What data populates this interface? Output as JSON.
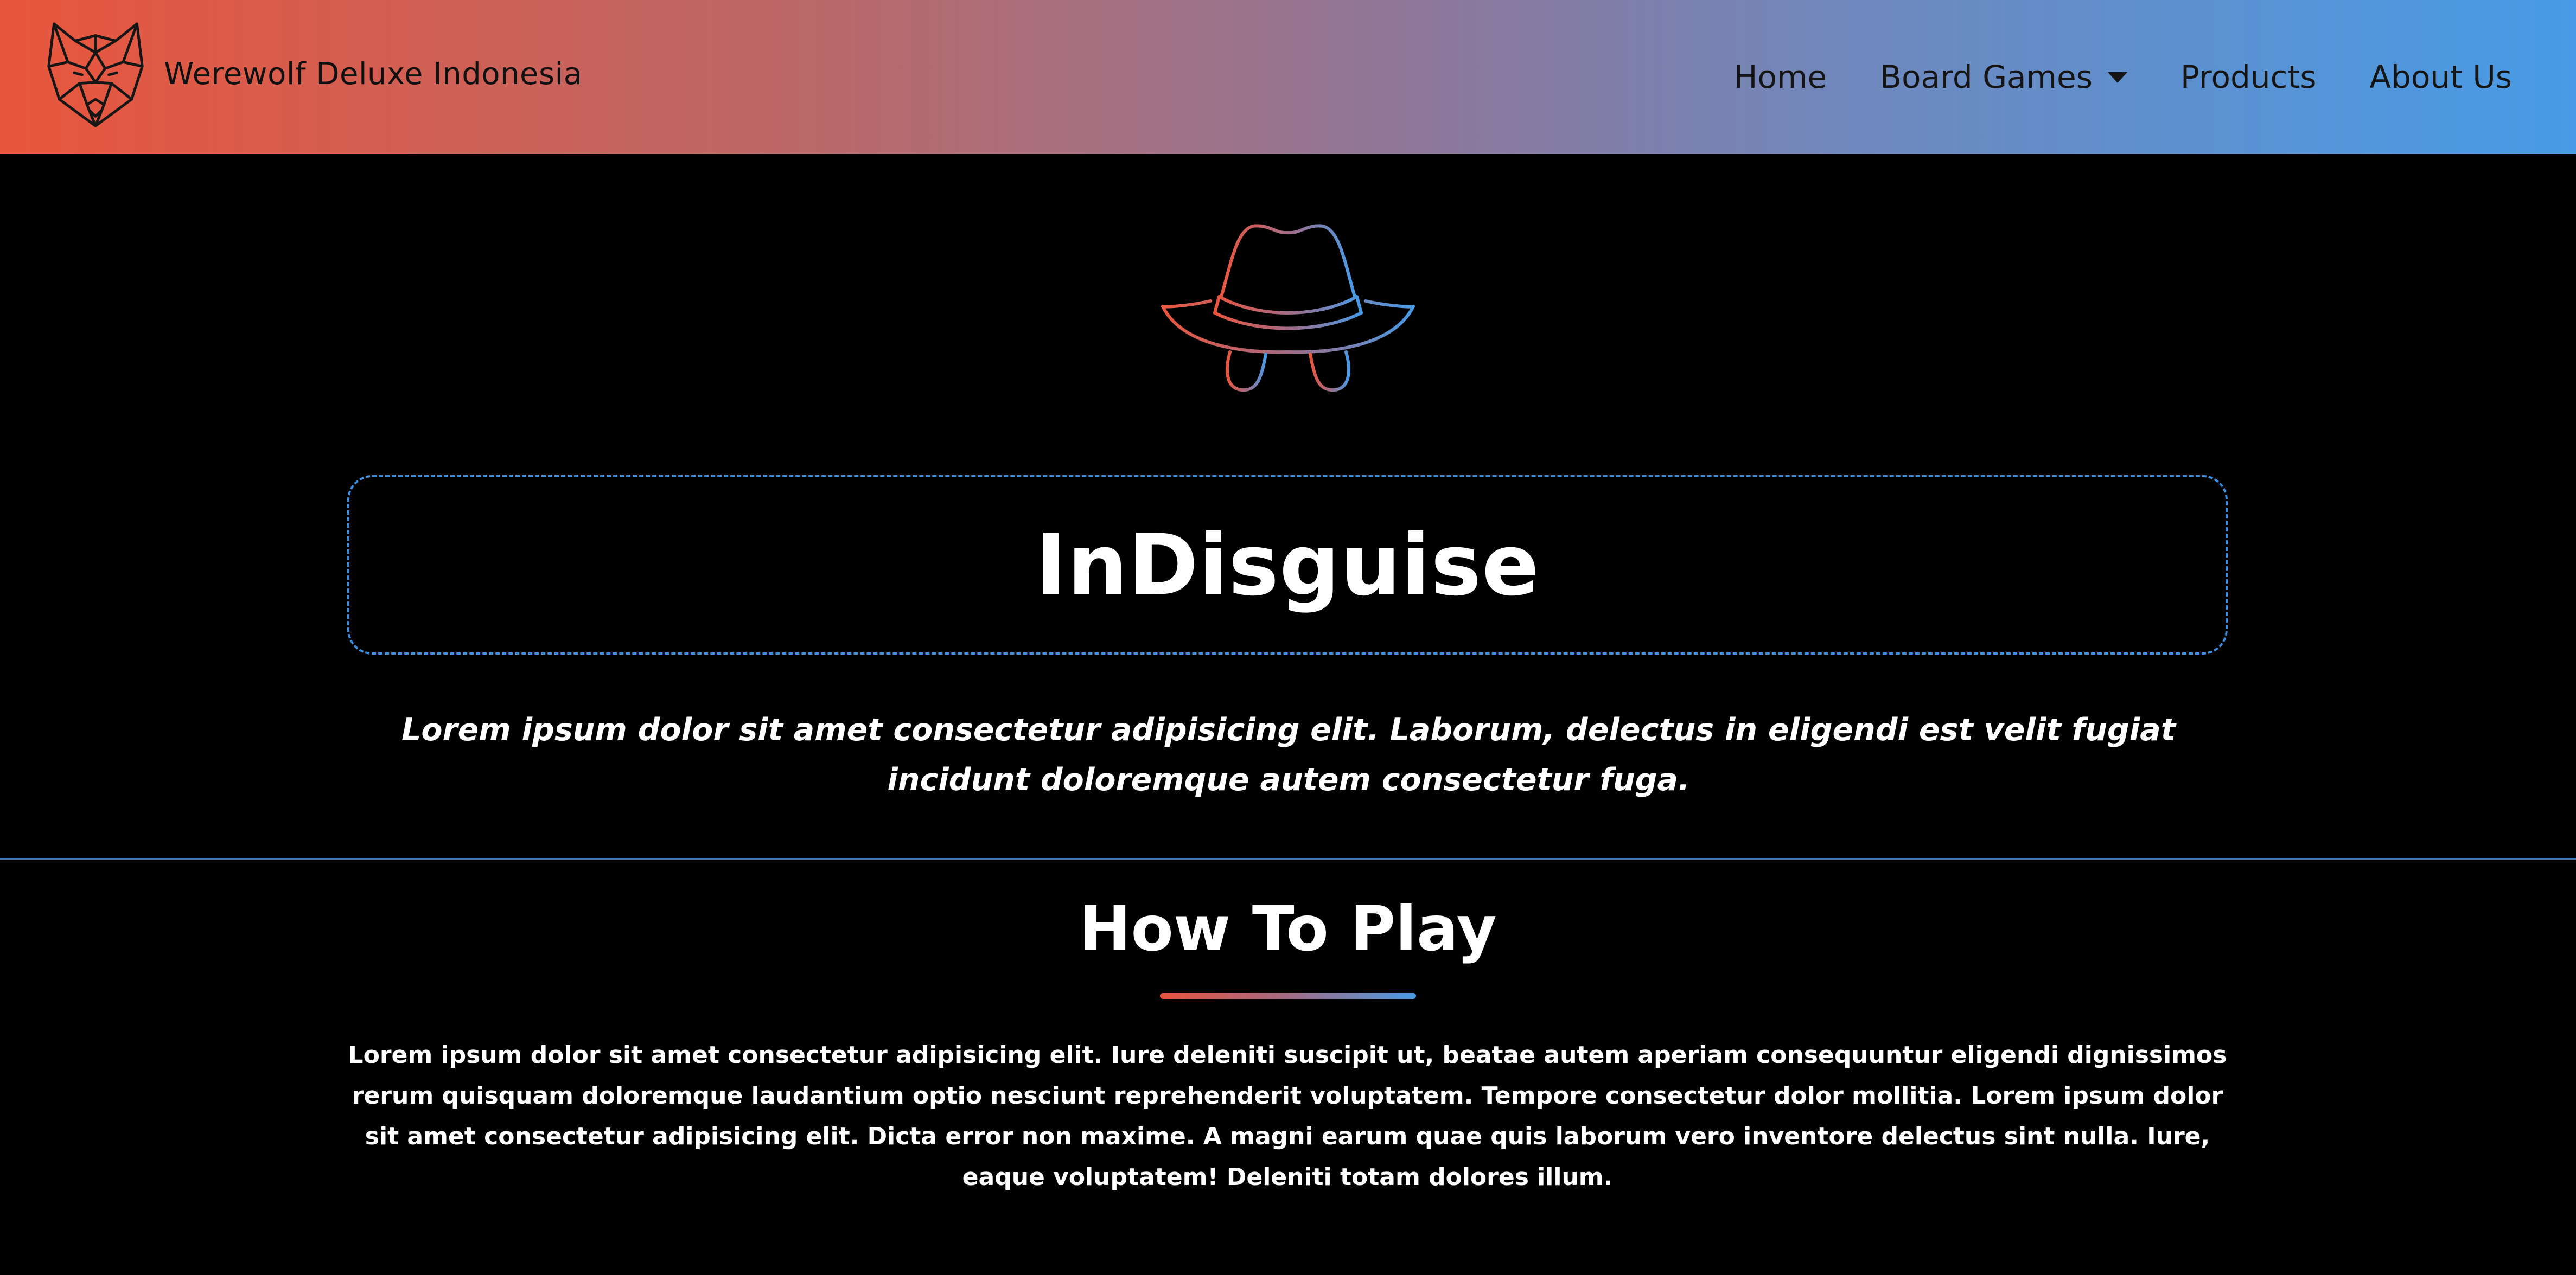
{
  "navbar": {
    "brand": "Werewolf Deluxe Indonesia",
    "links": [
      {
        "label": "Home"
      },
      {
        "label": "Board Games",
        "has_dropdown": true
      },
      {
        "label": "Products"
      },
      {
        "label": "About Us"
      }
    ],
    "gradient": [
      "#e9563d",
      "#479be6"
    ]
  },
  "hero": {
    "icon": "hat-spy-icon",
    "title": "InDisguise",
    "tagline": "Lorem ipsum dolor sit amet consectetur adipisicing elit. Laborum, delectus in eligendi est velit fugiat incidunt doloremque autem consectetur fuga.",
    "border_color": "#3d8fe0"
  },
  "how_to_play": {
    "heading": "How To Play",
    "text": "Lorem ipsum dolor sit amet consectetur adipisicing elit. Iure deleniti suscipit ut, beatae autem aperiam consequuntur eligendi dignissimos rerum quisquam doloremque laudantium optio nesciunt reprehenderit voluptatem. Tempore consectetur dolor mollitia. Lorem ipsum dolor sit amet consectetur adipisicing elit. Dicta error non maxime. A magni earum quae quis laborum vero inventore delectus sint nulla. Iure, eaque voluptatem! Deleniti totam dolores illum."
  }
}
